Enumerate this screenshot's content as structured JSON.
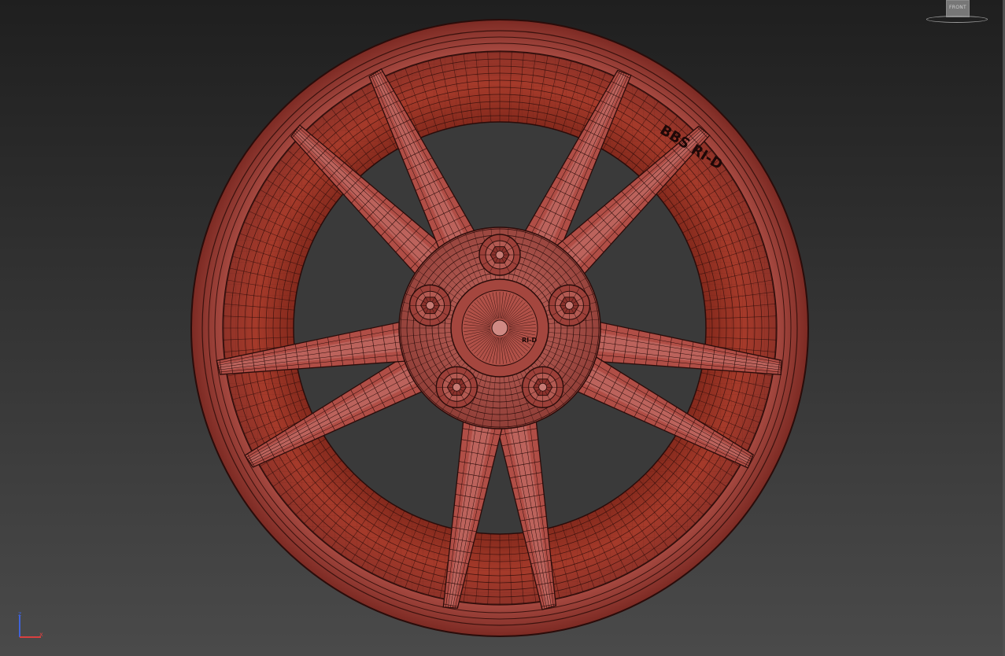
{
  "viewport": {
    "name": "perspective-viewport",
    "background_colors": [
      "#1f1f1f",
      "#4a4a4a"
    ]
  },
  "viewcube": {
    "face_label": "FRONT"
  },
  "axis_gizmo": {
    "z_label": "z",
    "x_label": "x",
    "z_color": "#3f63d8",
    "x_color": "#d94040"
  },
  "model": {
    "name": "wheel-rim-wireframe",
    "shading_color": "#b5473d",
    "wire_color": "#2a0c0a",
    "spoke_count": 10,
    "lug_count": 5,
    "rim_text": "BBS RI-D",
    "center_text": "RI-D"
  }
}
